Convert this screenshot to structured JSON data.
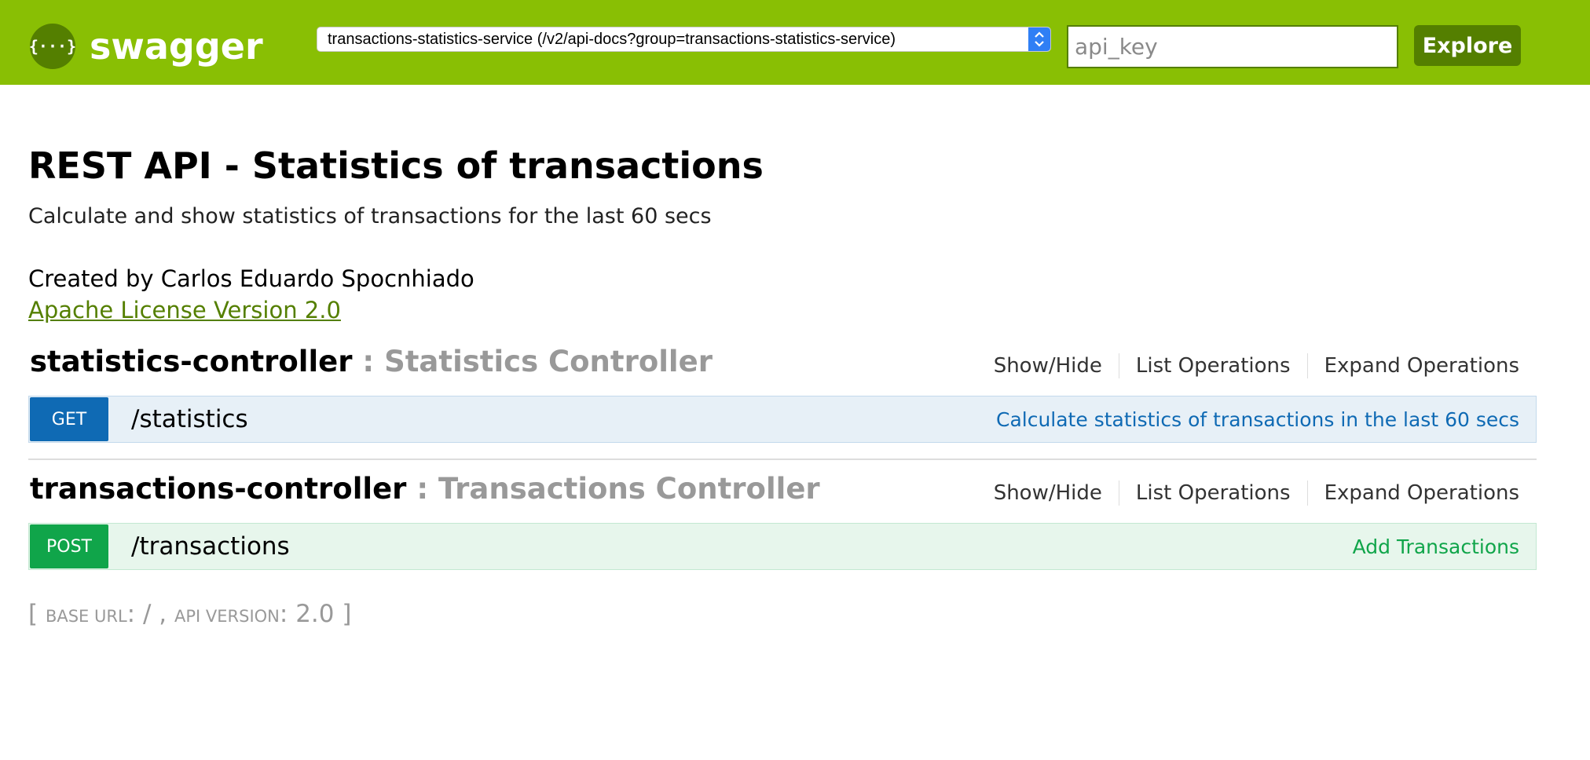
{
  "header": {
    "logo_text": "swagger",
    "logo_icon": "swagger-braces-icon",
    "spec_select": {
      "selected": "transactions-statistics-service (/v2/api-docs?group=transactions-statistics-service)",
      "arrow_icon": "select-updown-arrows-icon"
    },
    "api_key_placeholder": "api_key",
    "explore_label": "Explore",
    "colors": {
      "header_bg": "#89bf04",
      "accent_dark": "#547f00"
    }
  },
  "info": {
    "title": "REST API - Statistics of transactions",
    "description": "Calculate and show statistics of transactions for the last 60 secs",
    "creator": "Created by Carlos Eduardo Spocnhiado",
    "license": "Apache License Version 2.0"
  },
  "resources": [
    {
      "name": "statistics-controller",
      "description": " : Statistics Controller",
      "options": [
        "Show/Hide",
        "List Operations",
        "Expand Operations"
      ],
      "operation": {
        "method": "GET",
        "path": "/statistics",
        "summary": "Calculate statistics of transactions in the last 60 secs",
        "color": "#0f6ab4"
      }
    },
    {
      "name": "transactions-controller",
      "description": " : Transactions Controller",
      "options": [
        "Show/Hide",
        "List Operations",
        "Expand Operations"
      ],
      "operation": {
        "method": "POST",
        "path": "/transactions",
        "summary": "Add Transactions",
        "color": "#10a54a"
      }
    }
  ],
  "footer": {
    "open_bracket": "[ ",
    "base_url_label": "base url",
    "base_url_sep": ": ",
    "base_url_value": "/",
    "comma": " , ",
    "api_version_label": "api version",
    "api_version_sep": ": ",
    "api_version_value": "2.0",
    "close_bracket": " ]"
  }
}
